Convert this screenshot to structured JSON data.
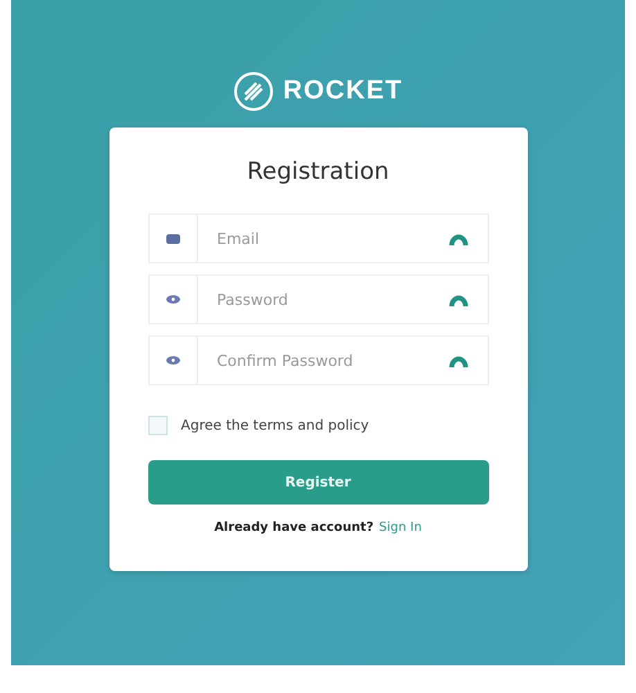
{
  "logo": {
    "name": "ROCKET"
  },
  "card": {
    "title": "Registration",
    "fields": [
      {
        "kind": "email",
        "placeholder": "Email"
      },
      {
        "kind": "password",
        "placeholder": "Password"
      },
      {
        "kind": "password",
        "placeholder": "Confirm Password"
      }
    ],
    "agree": {
      "label": "Agree the terms and policy",
      "checked": false
    },
    "button": "Register",
    "footer": {
      "text": "Already have account?",
      "link": "Sign In"
    }
  }
}
